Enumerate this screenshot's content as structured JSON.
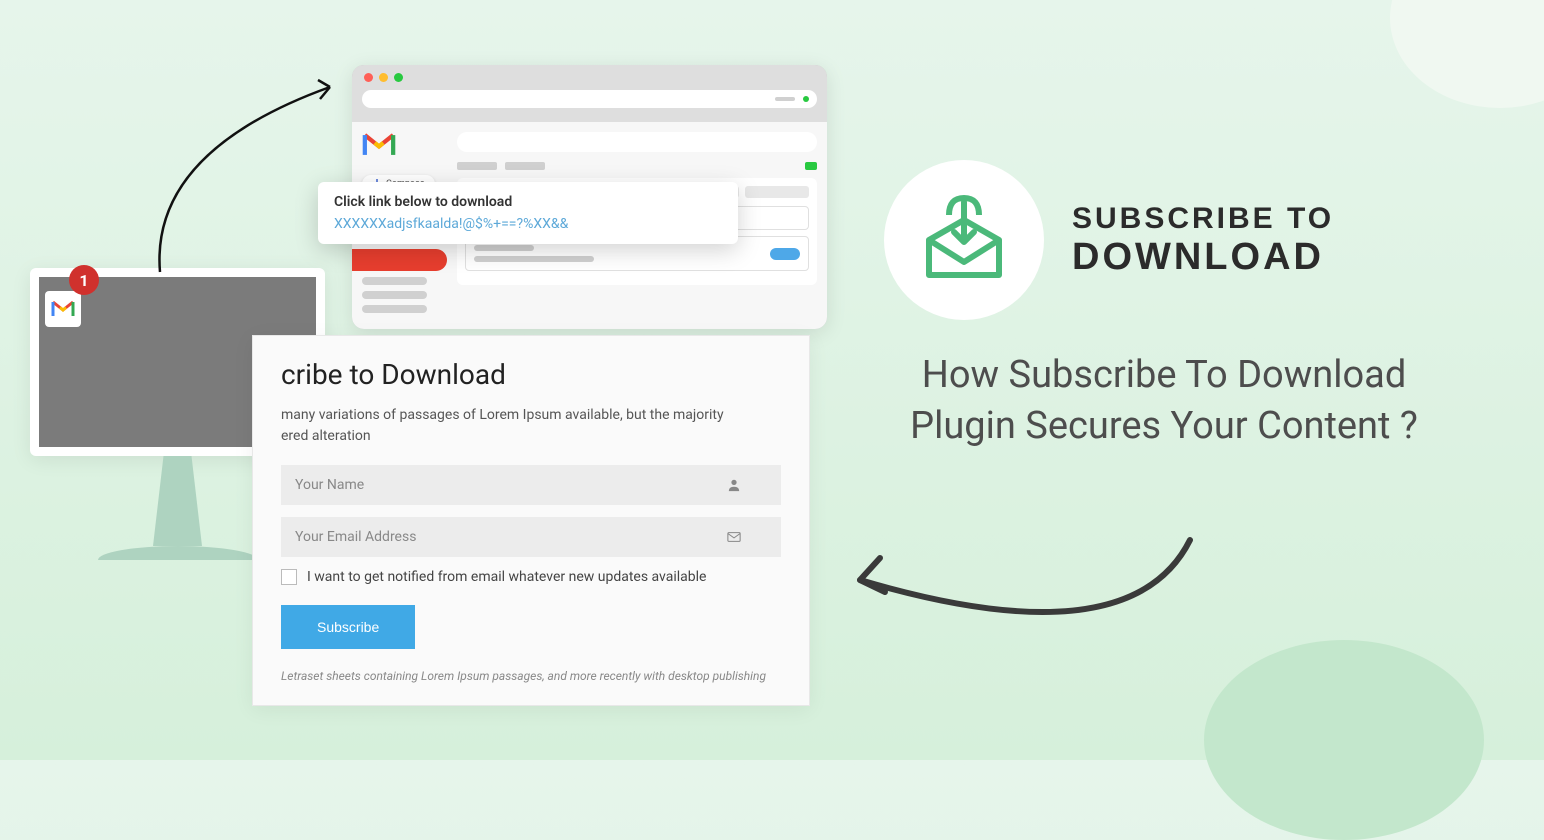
{
  "monitor": {
    "badge": "1"
  },
  "browser": {
    "compose": "Compose"
  },
  "tooltip": {
    "title": "Click link below to download",
    "link": "XXXXXXadjsfkaalda!@$%+==?%XX&&"
  },
  "form": {
    "title_suffix": "cribe to Download",
    "desc_line1": "many variations of passages of Lorem Ipsum available, but the majority",
    "desc_line2": "ered alteration",
    "name_placeholder": "Your Name",
    "email_placeholder": "Your Email Address",
    "checkbox_label": "I want to get notified from email whatever new updates available",
    "button": "Subscribe",
    "footer": "Letraset sheets containing Lorem Ipsum passages, and more recently with desktop publishing"
  },
  "brand": {
    "top": "SUBSCRIBE TO",
    "bottom": "DOWNLOAD"
  },
  "headline": "How Subscribe To Download Plugin Secures Your Content ?"
}
